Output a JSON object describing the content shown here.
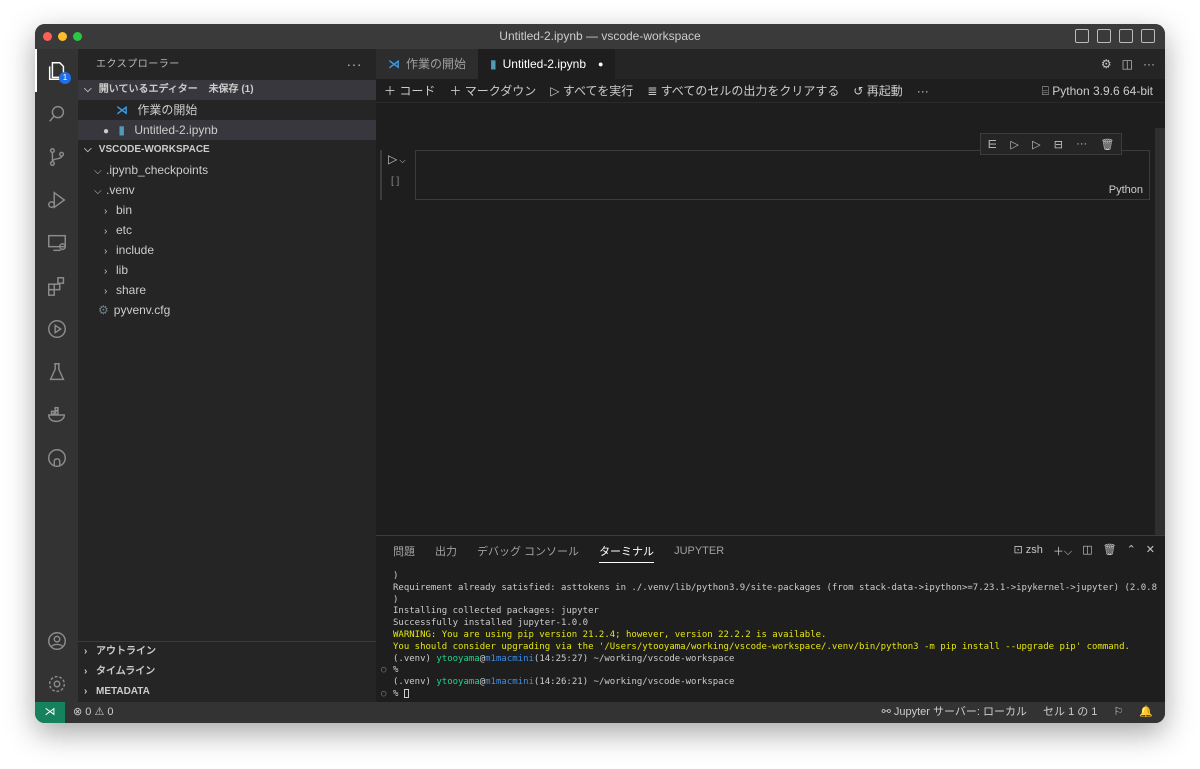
{
  "window": {
    "title": "Untitled-2.ipynb — vscode-workspace"
  },
  "activity": {
    "badge": "1"
  },
  "sidebar": {
    "title": "エクスプローラー",
    "more": "···",
    "open_editors": {
      "label": "開いているエディター",
      "unsaved": "未保存 (1)"
    },
    "open_files": [
      "作業の開始",
      "Untitled-2.ipynb"
    ],
    "workspace": "VSCODE-WORKSPACE",
    "tree": [
      ".ipynb_checkpoints",
      ".venv",
      "bin",
      "etc",
      "include",
      "lib",
      "share",
      "pyvenv.cfg"
    ],
    "bottom_sections": [
      "アウトライン",
      "タイムライン",
      "METADATA"
    ]
  },
  "editor": {
    "tabs": [
      "作業の開始",
      "Untitled-2.ipynb"
    ],
    "toolbar": {
      "add_code": "コード",
      "add_markdown": "マークダウン",
      "run_all": "すべてを実行",
      "clear_outputs": "すべてのセルの出力をクリアする",
      "restart": "再起動",
      "more": "···",
      "kernel": "Python 3.9.6 64-bit"
    },
    "cell": {
      "exec_count": "[ ]",
      "language": "Python"
    }
  },
  "panel": {
    "tabs": [
      "問題",
      "出力",
      "デバッグ コンソール",
      "ターミナル",
      "JUPYTER"
    ],
    "shell": "zsh",
    "terminal": {
      "l1": ")",
      "l2": "Requirement already satisfied: asttokens in ./.venv/lib/python3.9/site-packages (from stack-data->ipython>=7.23.1->ipykernel->jupyter) (2.0.8",
      "l3": ")",
      "l4": "Installing collected packages: jupyter",
      "l5": "Successfully installed jupyter-1.0.0",
      "l6": "WARNING: You are using pip version 21.2.4; however, version 22.2.2 is available.",
      "l7": "You should consider upgrading via the '/Users/ytooyama/working/vscode-workspace/.venv/bin/python3 -m pip install --upgrade pip' command.",
      "p1_env": "(.venv) ",
      "user": "ytooyama",
      "host": "m1macmini",
      "p1_rest": "(14:25:27) ~/working/vscode-workspace",
      "pct": "%",
      "p2_rest": "(14:26:21) ~/working/vscode-workspace"
    }
  },
  "status": {
    "problems": "0",
    "warnings": "0",
    "jupyter": "Jupyter サーバー: ローカル",
    "cell": "セル 1 の 1"
  }
}
